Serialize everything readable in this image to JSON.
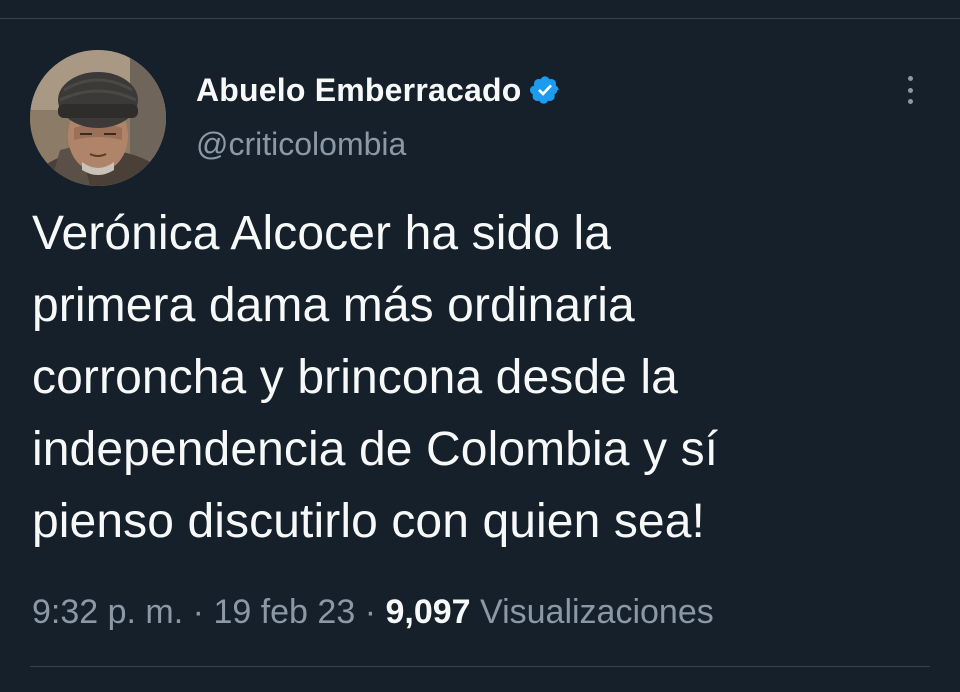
{
  "tweet": {
    "author": {
      "display_name": "Abuelo Emberracado",
      "handle": "@criticolombia",
      "verified": true,
      "avatar_icon": "avatar-photo-elderly-man-knit-cap"
    },
    "text": "Verónica Alcocer ha sido la\nprimera dama más ordinaria\ncorroncha y brincona desde la\nindependencia de Colombia y sí\npienso discutirlo con quien sea!",
    "time": "9:32 p. m.",
    "separator": "·",
    "date": "19 feb 23",
    "views_count": "9,097",
    "views_label": "Visualizaciones"
  },
  "colors": {
    "background": "#15202b",
    "primary_text": "#f7f9f9",
    "secondary_text": "#8b98a5",
    "verified_badge": "#1d9bf0",
    "divider": "#38444d"
  },
  "icons": {
    "verified": "verified-badge-icon",
    "more": "more-options-icon"
  }
}
